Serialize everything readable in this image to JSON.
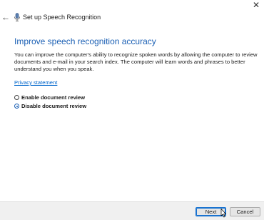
{
  "window": {
    "title": "Set up Speech Recognition",
    "close_icon": "close-icon",
    "back_icon": "back-arrow-icon",
    "app_icon": "microphone-icon"
  },
  "content": {
    "heading": "Improve speech recognition accuracy",
    "description": "You can improve the computer's ability to recognize spoken words by allowing the computer to review documents and e-mail in your search index. The computer will learn words and phrases to better understand you when you speak.",
    "privacy_link": "Privacy statement",
    "options": [
      {
        "label": "Enable document review",
        "selected": false
      },
      {
        "label": "Disable document review",
        "selected": true
      }
    ]
  },
  "footer": {
    "next_label": "Next",
    "cancel_label": "Cancel"
  },
  "colors": {
    "heading": "#1a5fb4",
    "link": "#0066cc",
    "footer_bg": "#f0f0f0"
  }
}
